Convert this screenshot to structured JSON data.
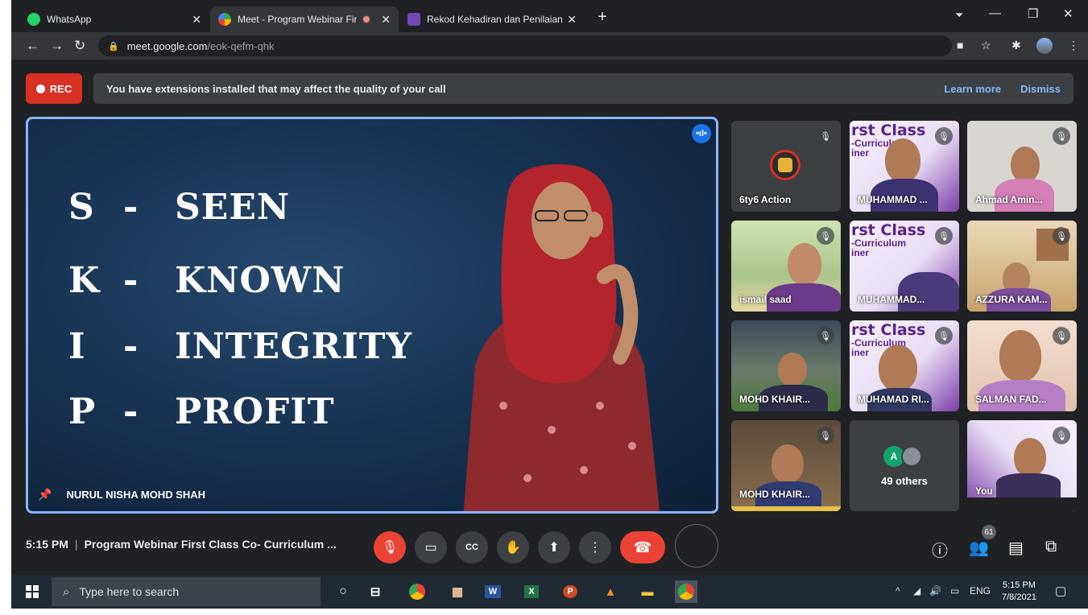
{
  "browser": {
    "tabs": [
      {
        "title": "WhatsApp",
        "active": false
      },
      {
        "title": "Meet - Program Webinar First",
        "active": true
      },
      {
        "title": "Rekod Kehadiran dan Penilaian K",
        "active": false
      }
    ],
    "url_host": "meet.google.com",
    "url_path": "/eok-qefm-qhk"
  },
  "meet": {
    "rec_label": "REC",
    "banner": {
      "message": "You have extensions installed that may affect the quality of your call",
      "learn_more": "Learn more",
      "dismiss": "Dismiss"
    },
    "slide": {
      "lines": [
        {
          "letter": "S",
          "dash": "-",
          "word": "SEEN"
        },
        {
          "letter": "K",
          "dash": "-",
          "word": "KNOWN"
        },
        {
          "letter": "I",
          "dash": "-",
          "word": "INTEGRITY"
        },
        {
          "letter": "P",
          "dash": "-",
          "word": "PROFIT"
        }
      ]
    },
    "speaker_name": "NURUL NISHA MOHD SHAH",
    "participants": [
      {
        "name": "6ty6 Action"
      },
      {
        "name": "MUHAMMAD ..."
      },
      {
        "name": "Ahmad Amin..."
      },
      {
        "name": "ismail saad"
      },
      {
        "name": "MUHAMMAD..."
      },
      {
        "name": "AZZURA KAM..."
      },
      {
        "name": "MOHD KHAIR..."
      },
      {
        "name": "MUHAMAD RI..."
      },
      {
        "name": "SALMAN FAD..."
      },
      {
        "name": "MOHD KHAIR..."
      },
      {
        "name": "49 others"
      },
      {
        "name": "You"
      }
    ],
    "poster_text_line1": "rst Class",
    "poster_text_line2": "-Curriculum",
    "poster_text_line3": "iner",
    "others_avatar_letter": "A",
    "call_time": "5:15 PM",
    "meeting_title": "Program Webinar First Class Co- Curriculum ...",
    "people_count": "61"
  },
  "taskbar": {
    "search_placeholder": "Type here to search",
    "language": "ENG",
    "time": "5:15 PM",
    "date": "7/8/2021"
  },
  "colors": {
    "rec_red": "#d93025",
    "accent_blue": "#8ab4f8",
    "hangup_red": "#ea4335",
    "poster_purple": "#5b2287"
  }
}
